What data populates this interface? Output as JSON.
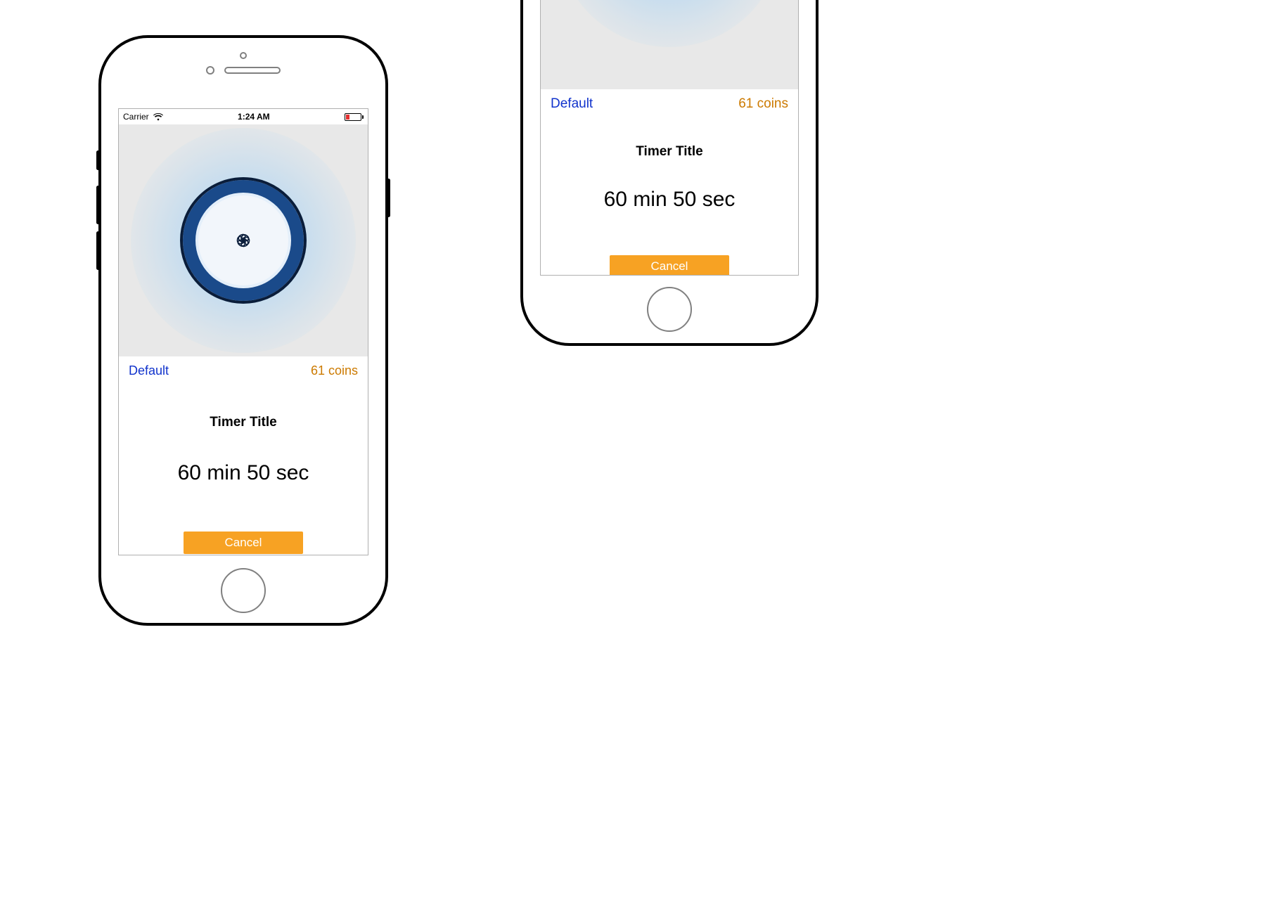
{
  "phone1": {
    "status": {
      "carrier": "Carrier",
      "wifi_icon": "wifi-icon",
      "time": "1:24 AM",
      "battery_icon": "battery-low-icon"
    },
    "hero_icon": "ornate-coin-icon",
    "sounds_label": "Default",
    "coins_label": "61 coins",
    "timer_title": "Timer Title",
    "timer_value": "60 min 50 sec",
    "cancel_label": "Cancel"
  },
  "phone2": {
    "hero_icon": "ornate-coin-icon",
    "sounds_label": "Default",
    "coins_label": "61 coins",
    "timer_title": "Timer Title",
    "timer_value": "60 min 50 sec",
    "cancel_label": "Cancel"
  },
  "colors": {
    "link_blue": "#1133cc",
    "accent_orange": "#f7a223",
    "coins_orange": "#cc7a00",
    "battery_low_red": "#e53030"
  }
}
